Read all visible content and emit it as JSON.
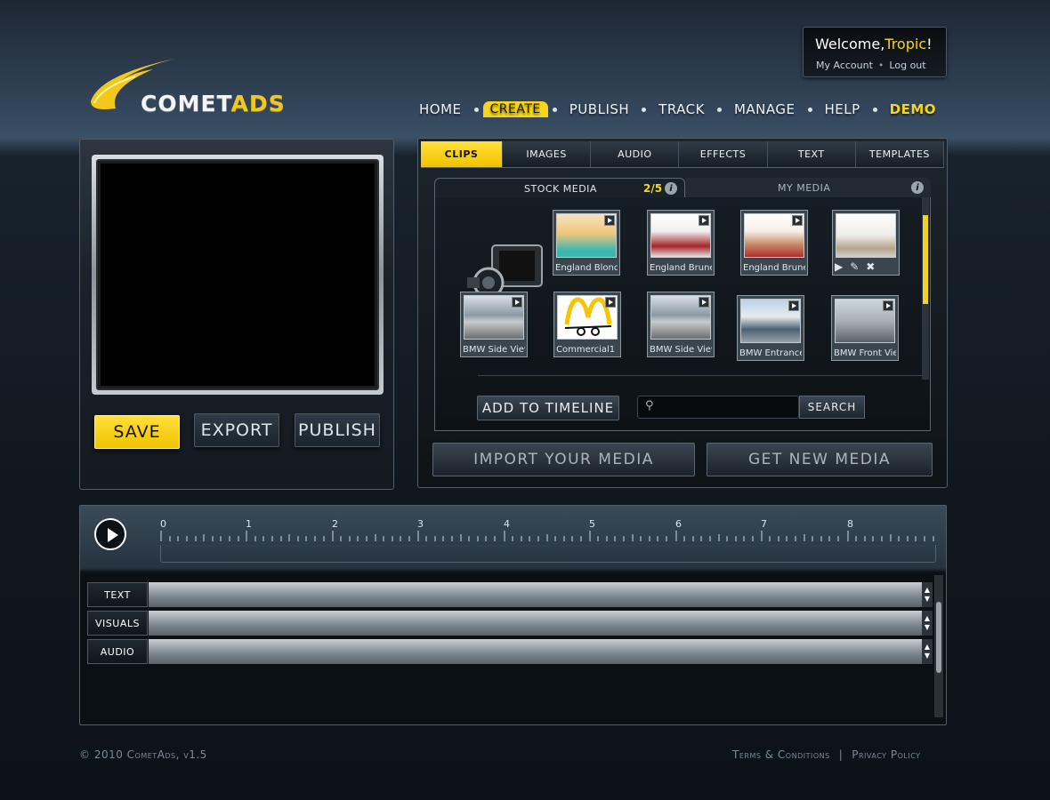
{
  "user": {
    "welcome_prefix": "Welcome,",
    "name": "Tropic",
    "welcome_suffix": "!",
    "my_account": "My Account",
    "logout": "Log out"
  },
  "brand": {
    "name_part1": "COMET",
    "name_part2": "ADS"
  },
  "nav": {
    "items": [
      "HOME",
      "CREATE",
      "PUBLISH",
      "TRACK",
      "MANAGE",
      "HELP",
      "DEMO"
    ],
    "active": "CREATE"
  },
  "preview": {
    "save": "SAVE",
    "export": "EXPORT",
    "publish": "PUBLISH"
  },
  "media_tabs": [
    "CLIPS",
    "IMAGES",
    "AUDIO",
    "EFFECTS",
    "TEXT",
    "TEMPLATES"
  ],
  "media_subtabs": {
    "stock": "STOCK MEDIA",
    "count": "2/5",
    "my": "MY MEDIA",
    "info": "i"
  },
  "clips": [
    {
      "caption": "England Blonde"
    },
    {
      "caption": "England Brunette"
    },
    {
      "caption": "England Brunette"
    },
    {
      "caption": ""
    },
    {
      "caption": "BMW Side View"
    },
    {
      "caption": "Commercial1"
    },
    {
      "caption": "BMW Side View"
    },
    {
      "caption": "BMW Entrance"
    },
    {
      "caption": "BMW Front View"
    }
  ],
  "actions": {
    "add_to_timeline": "ADD TO TIMELINE",
    "search": "SEARCH",
    "search_placeholder": "",
    "import": "IMPORT YOUR MEDIA",
    "get_new": "GET NEW MEDIA"
  },
  "timeline": {
    "ticks": [
      "0",
      "1",
      "2",
      "3",
      "4",
      "5",
      "6",
      "7",
      "8"
    ],
    "tracks": [
      "TEXT",
      "VISUALS",
      "AUDIO"
    ]
  },
  "footer": {
    "copyright": "© 2010 CometAds, v1.5",
    "terms": "Terms & Conditions",
    "sep": "|",
    "privacy": "Privacy Policy"
  },
  "colors": {
    "accent": "#f6d51a",
    "background": "#16202a"
  }
}
